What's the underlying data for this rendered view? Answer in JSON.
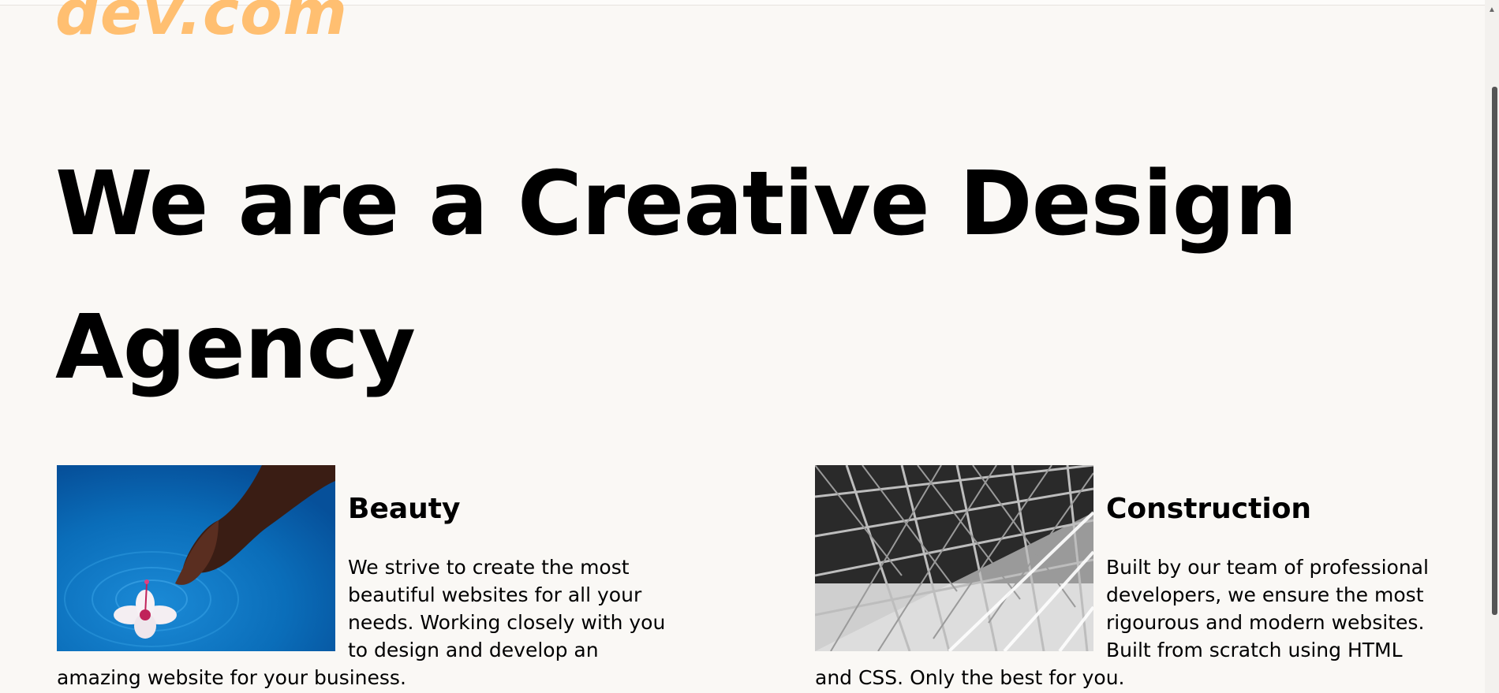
{
  "logo": {
    "text": "dev.com",
    "color": "#ffbf71"
  },
  "hero": {
    "title": "We are a Creative Design Agency"
  },
  "services": [
    {
      "title": "Beauty",
      "body": "We strive to create the most beautiful websites for all your needs. Working closely with you to design and develop an amazing website for your business."
    },
    {
      "title": "Construction",
      "body": "Built by our team of professional developers, we ensure the most rigourous and modern websites. Built from scratch using HTML and CSS. Only the best for you."
    }
  ],
  "scrollbar": {
    "up_icon": "chevron-up-icon"
  }
}
